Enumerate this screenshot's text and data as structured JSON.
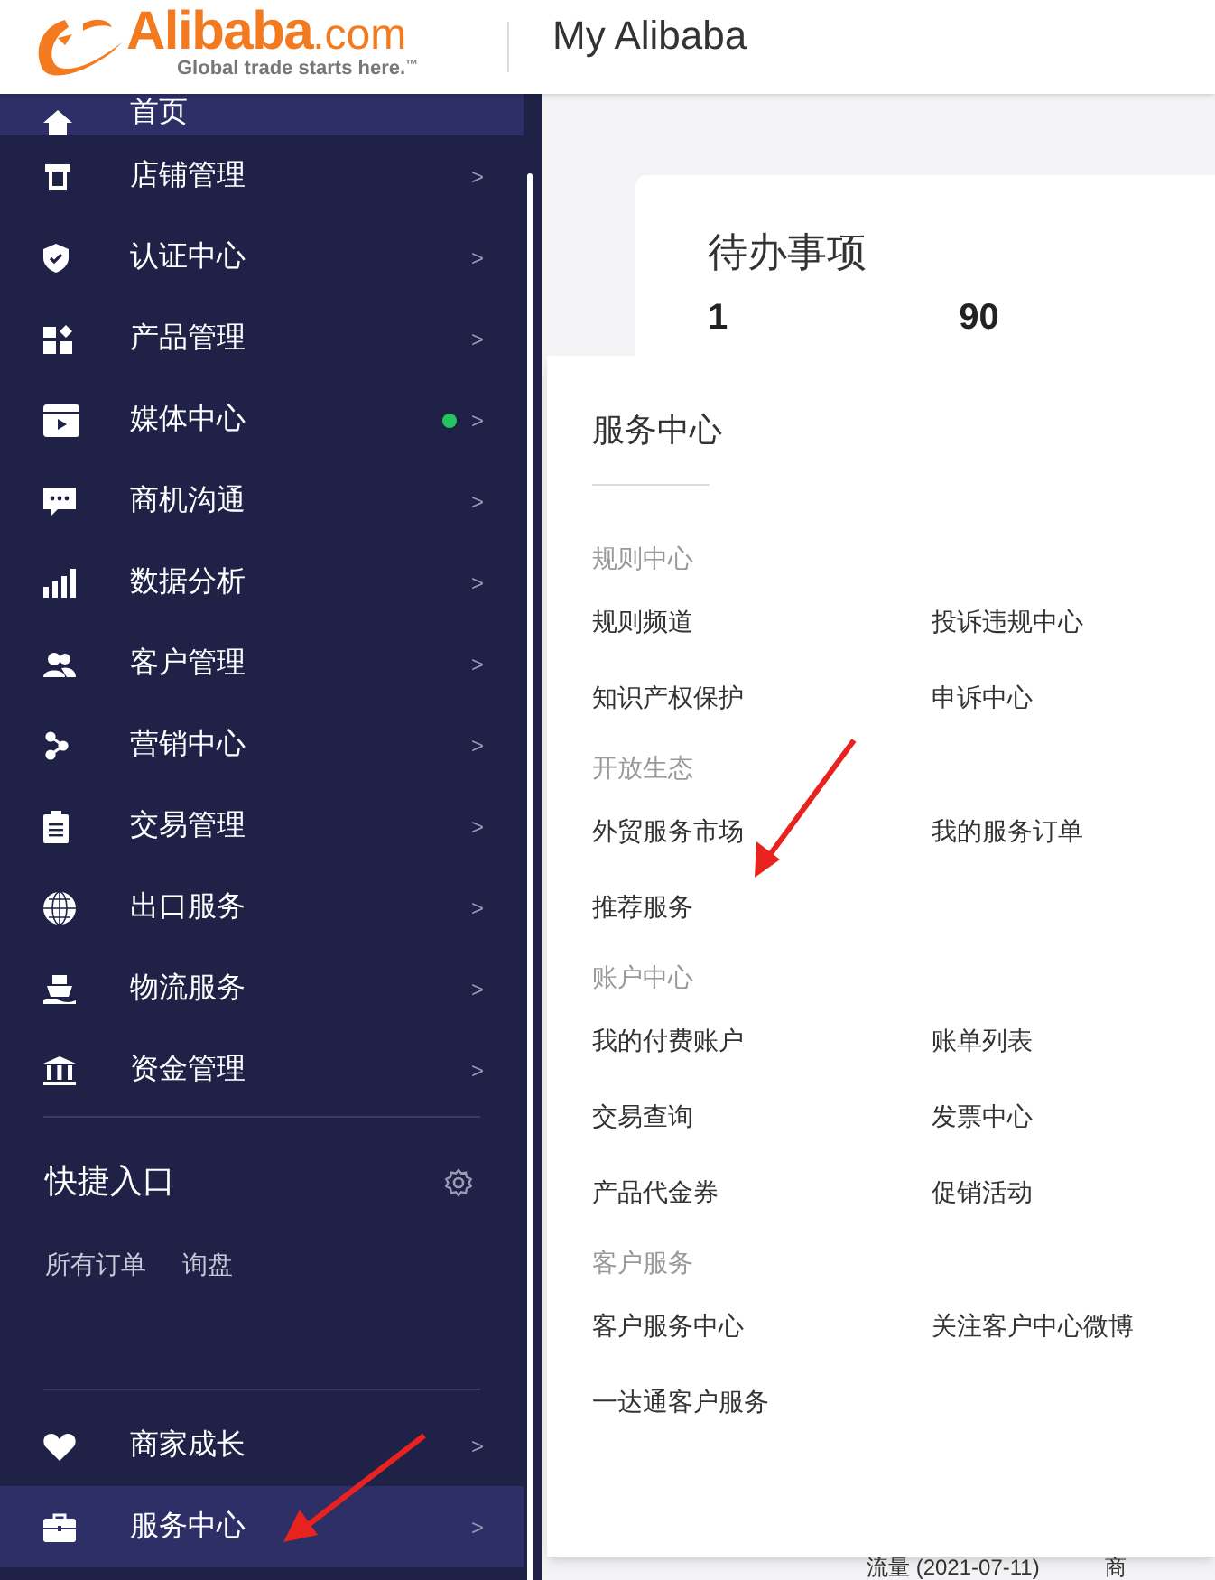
{
  "header": {
    "logo": {
      "brand": "Alibaba",
      ".com": ".com",
      "tagline": "Global trade starts here.",
      "tm": "™"
    },
    "title": "My Alibaba"
  },
  "sidebar": {
    "items": [
      {
        "label": "首页",
        "selected": true,
        "dot": false
      },
      {
        "label": "店铺管理",
        "selected": false,
        "dot": false,
        "arrow": ">"
      },
      {
        "label": "认证中心",
        "selected": false,
        "dot": false,
        "arrow": ">"
      },
      {
        "label": "产品管理",
        "selected": false,
        "dot": false,
        "arrow": ">"
      },
      {
        "label": "媒体中心",
        "selected": false,
        "dot": true,
        "arrow": ">"
      },
      {
        "label": "商机沟通",
        "selected": false,
        "dot": false,
        "arrow": ">"
      },
      {
        "label": "数据分析",
        "selected": false,
        "dot": false,
        "arrow": ">"
      },
      {
        "label": "客户管理",
        "selected": false,
        "dot": false,
        "arrow": ">"
      },
      {
        "label": "营销中心",
        "selected": false,
        "dot": false,
        "arrow": ">"
      },
      {
        "label": "交易管理",
        "selected": false,
        "dot": false,
        "arrow": ">"
      },
      {
        "label": "出口服务",
        "selected": false,
        "dot": false,
        "arrow": ">"
      },
      {
        "label": "物流服务",
        "selected": false,
        "dot": false,
        "arrow": ">"
      },
      {
        "label": "资金管理",
        "selected": false,
        "dot": false,
        "arrow": ">"
      }
    ],
    "shortcuts": {
      "title": "快捷入口",
      "links": [
        "所有订单",
        "询盘"
      ]
    },
    "bottom_items": [
      {
        "label": "商家成长",
        "selected": false,
        "arrow": ">"
      },
      {
        "label": "服务中心",
        "selected": true,
        "arrow": ">"
      }
    ]
  },
  "card": {
    "title": "待办事项",
    "counts": [
      "1",
      "90"
    ]
  },
  "flyout": {
    "title": "服务中心",
    "sections": [
      {
        "heading": "规则中心",
        "links": [
          "规则频道",
          "投诉违规中心",
          "知识产权保护",
          "申诉中心"
        ]
      },
      {
        "heading": "开放生态",
        "links": [
          "外贸服务市场",
          "我的服务订单",
          "推荐服务"
        ]
      },
      {
        "heading": "账户中心",
        "links": [
          "我的付费账户",
          "账单列表",
          "交易查询",
          "发票中心",
          "产品代金券",
          "促销活动"
        ]
      },
      {
        "heading": "客户服务",
        "links": [
          "客户服务中心",
          "关注客户中心微博",
          "一达通客户服务"
        ]
      }
    ]
  },
  "background_text": [
    "流量 (2021-07-11)",
    "商"
  ]
}
